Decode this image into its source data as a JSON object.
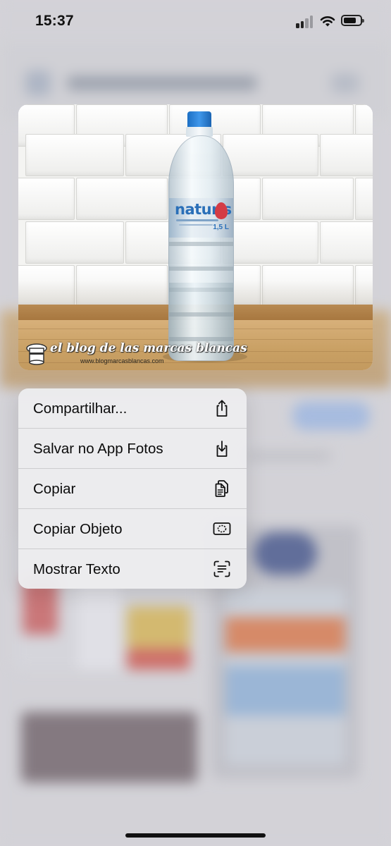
{
  "status_bar": {
    "time": "15:37",
    "signal_icon": "cellular-signal-icon",
    "wifi_icon": "wifi-icon",
    "battery_icon": "battery-icon"
  },
  "preview": {
    "product_brand": "naturis",
    "product_volume": "1,5 L",
    "watermark_title": "el blog de las marcas blancas",
    "watermark_url": "www.blogmarcasblancas.com"
  },
  "context_menu": {
    "items": [
      {
        "label": "Compartilhar...",
        "icon": "share-icon"
      },
      {
        "label": "Salvar no App Fotos",
        "icon": "save-to-photos-icon"
      },
      {
        "label": "Copiar",
        "icon": "copy-icon"
      },
      {
        "label": "Copiar Objeto",
        "icon": "copy-subject-icon"
      },
      {
        "label": "Mostrar Texto",
        "icon": "show-text-icon"
      }
    ]
  },
  "colors": {
    "menu_background": "#ececee",
    "text": "#0b0b0b",
    "bottle_cap": "#2f86dd"
  }
}
